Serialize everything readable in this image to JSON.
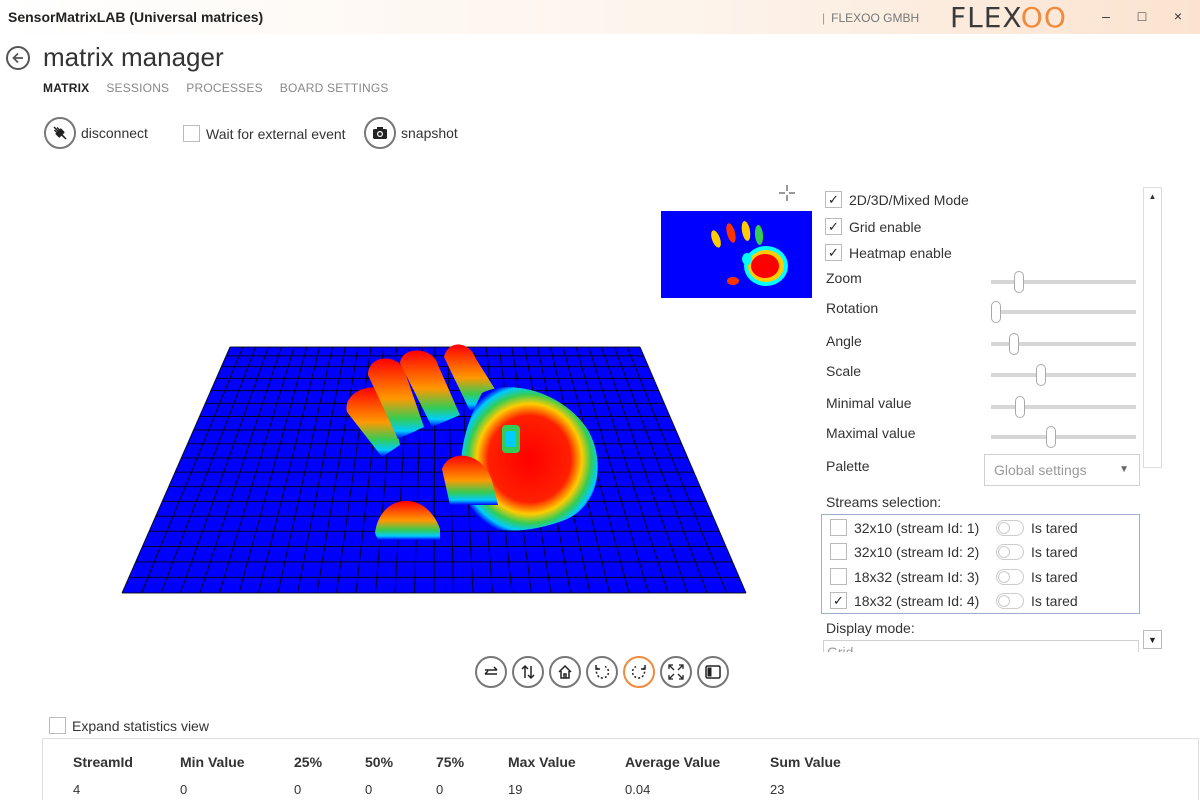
{
  "window": {
    "title": "SensorMatrixLAB (Universal matrices)",
    "company": "FLEXOO GMBH",
    "brand_prefix": "FLEX",
    "brand_suffix": "OO",
    "minimize": "–",
    "maximize": "□",
    "close": "×"
  },
  "header": {
    "title": "matrix manager",
    "tabs": [
      {
        "label": "MATRIX"
      },
      {
        "label": "SESSIONS"
      },
      {
        "label": "PROCESSES"
      },
      {
        "label": "BOARD SETTINGS"
      }
    ]
  },
  "toolbar": {
    "disconnect": "disconnect",
    "wait_external": "Wait for external event",
    "snapshot": "snapshot"
  },
  "options": {
    "mode": {
      "label": "2D/3D/Mixed Mode",
      "checked": true
    },
    "grid": {
      "label": "Grid enable",
      "checked": true
    },
    "heatmap": {
      "label": "Heatmap enable",
      "checked": true
    }
  },
  "sliders": [
    {
      "label": "Zoom",
      "value": 0.17
    },
    {
      "label": "Rotation",
      "value": 0.0
    },
    {
      "label": "Angle",
      "value": 0.13
    },
    {
      "label": "Scale",
      "value": 0.33
    },
    {
      "label": "Minimal value",
      "value": 0.18
    },
    {
      "label": "Maximal value",
      "value": 0.41
    }
  ],
  "palette": {
    "label": "Palette",
    "value": "Global settings"
  },
  "streams": {
    "label": "Streams selection:",
    "items": [
      {
        "name": "32x10 (stream Id: 1)",
        "checked": false,
        "tared_label": "Is tared"
      },
      {
        "name": "32x10 (stream Id: 2)",
        "checked": false,
        "tared_label": "Is tared"
      },
      {
        "name": "18x32 (stream Id: 3)",
        "checked": false,
        "tared_label": "Is tared"
      },
      {
        "name": "18x32 (stream Id: 4)",
        "checked": true,
        "tared_label": "Is tared"
      }
    ]
  },
  "display_mode": {
    "label": "Display mode:",
    "value": "Grid"
  },
  "statistics": {
    "expand_label": "Expand statistics view",
    "columns": [
      "StreamId",
      "Min Value",
      "25%",
      "50%",
      "75%",
      "Max Value",
      "Average Value",
      "Sum Value"
    ],
    "rows": [
      [
        "4",
        "0",
        "0",
        "0",
        "0",
        "19",
        "0.04",
        "23"
      ]
    ]
  },
  "colors": {
    "accent": "#f08a3c",
    "heatmap_base": "#0000ff",
    "heatmap_peak": "#ff0000"
  }
}
